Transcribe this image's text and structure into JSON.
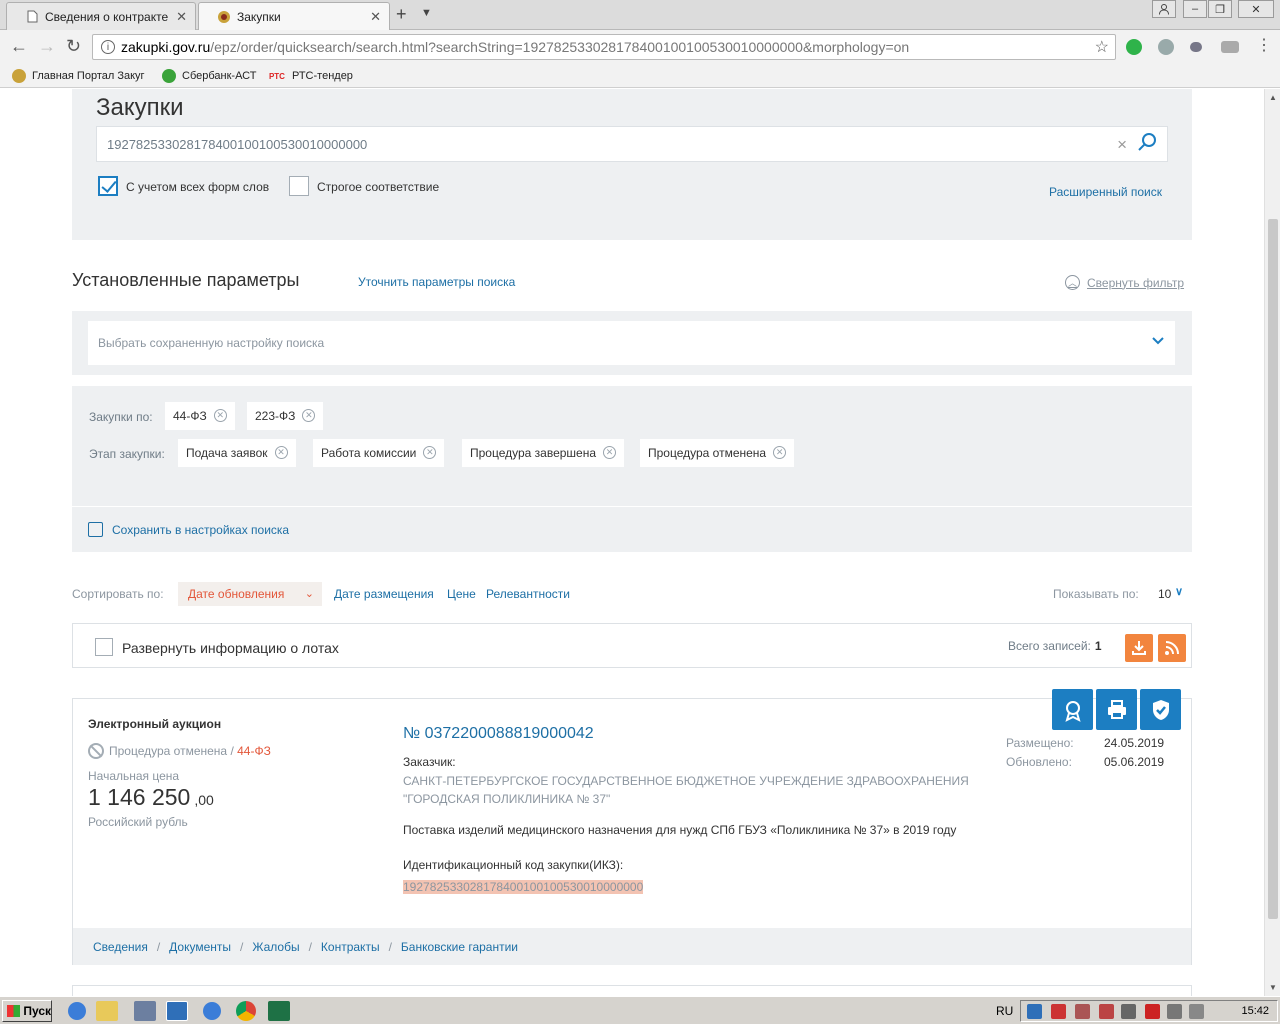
{
  "browser": {
    "tabs": [
      {
        "title": "Сведения о контракте",
        "active": false
      },
      {
        "title": "Закупки",
        "active": true
      }
    ],
    "url_host": "zakupki.gov.ru",
    "url_path": "/epz/order/quicksearch/search.html?searchString=192782533028178400100100530010000000&morphology=on",
    "bookmarks": [
      "Главная Портал Закуг",
      "Сбербанк-АСТ",
      "РТС-тендер"
    ],
    "bookmark_icon_text": "РТС"
  },
  "search": {
    "title": "Закупки",
    "query": "192782533028178400100100530010000000",
    "morphology_label": "С учетом всех форм слов",
    "morphology_checked": true,
    "strict_label": "Строгое соответствие",
    "strict_checked": false,
    "advanced_link": "Расширенный поиск"
  },
  "params": {
    "title": "Установленные параметры",
    "refine_link": "Уточнить параметры поиска",
    "collapse_link": "Свернуть фильтр",
    "saved_placeholder": "Выбрать сохраненную настройку поиска",
    "law_label": "Закупки по:",
    "laws": [
      "44-ФЗ",
      "223-ФЗ"
    ],
    "stage_label": "Этап закупки:",
    "stages": [
      "Подача заявок",
      "Работа комиссии",
      "Процедура завершена",
      "Процедура отменена"
    ],
    "save_link": "Сохранить в настройках поиска"
  },
  "sort": {
    "label": "Сортировать по:",
    "active": "Дате обновления",
    "options": [
      "Дате размещения",
      "Цене",
      "Релевантности"
    ],
    "show_label": "Показывать по:",
    "show_value": "10"
  },
  "results": {
    "expand_label": "Развернуть информацию о лотах",
    "total_label": "Всего записей:",
    "total": "1"
  },
  "card": {
    "type": "Электронный аукцион",
    "status": "Процедура отменена",
    "status_sep": " / ",
    "law": "44-ФЗ",
    "price_label": "Начальная цена",
    "price": "1 146 250",
    "price_kop": ",00",
    "currency": "Российский рубль",
    "number": "№ 0372200088819000042",
    "customer_label": "Заказчик:",
    "customer": "САНКТ-ПЕТЕРБУРГСКОЕ ГОСУДАРСТВЕННОЕ БЮДЖЕТНОЕ УЧРЕЖДЕНИЕ ЗДРАВООХРАНЕНИЯ \"ГОРОДСКАЯ ПОЛИКЛИНИКА № 37\"",
    "description": "Поставка изделий медицинского назначения для нужд СПб ГБУЗ «Поликлиника № 37» в 2019 году",
    "ikz_label": "Идентификационный код закупки(ИКЗ):",
    "ikz": "192782533028178400100100530010000000",
    "posted_label": "Размещено:",
    "posted": "24.05.2019",
    "updated_label": "Обновлено:",
    "updated": "05.06.2019",
    "links": [
      "Сведения",
      "Документы",
      "Жалобы",
      "Контракты",
      "Банковские гарантии"
    ]
  },
  "taskbar": {
    "start": "Пуск",
    "lang": "RU",
    "time": "15:42"
  },
  "colors": {
    "accent_blue": "#1c7ec2",
    "link_blue": "#1d6fa5",
    "accent_orange": "#f2853e",
    "status_red": "#e3573a",
    "panel_bg": "#eef0f2"
  }
}
